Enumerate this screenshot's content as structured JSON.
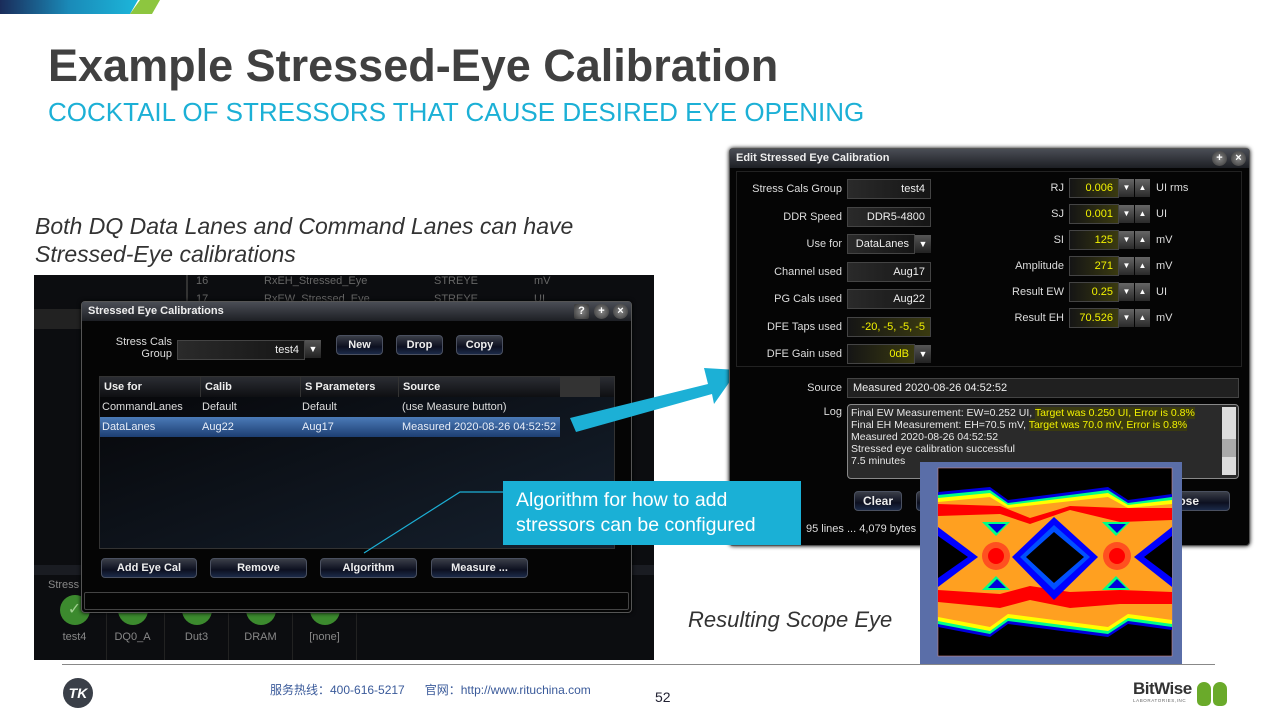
{
  "slide": {
    "title": "Example Stressed-Eye Calibration",
    "subtitle": "COCKTAIL OF STRESSORS THAT CAUSE DESIRED EYE OPENING",
    "note_line1": "Both DQ Data Lanes and Command Lanes can have",
    "note_line2": "Stressed-Eye calibrations",
    "callout_line1": "Algorithm for how to add",
    "callout_line2": "stressors can be configured",
    "scope_caption": "Resulting Scope Eye",
    "page_number": "52",
    "footer_hotline": "服务热线：400-616-5217",
    "footer_web": "官网：http://www.rituchina.com",
    "brand_logo": "BitWise",
    "brand_sub": "LABORATORIES,INC",
    "left_logo": "TK",
    "accent": "#1cb0d6",
    "accent_green": "#8dc63f"
  },
  "background_app": {
    "rows": [
      {
        "num": "16",
        "name": "RxEH_Stressed_Eye",
        "type": "STREYE",
        "unit": "mV"
      },
      {
        "num": "17",
        "name": "RxEW_Stressed_Eye",
        "type": "STREYE",
        "unit": "UI"
      }
    ],
    "tiles_label": "Stress",
    "tiles": [
      "test4",
      "DQ0_A",
      "Dut3",
      "DRAM",
      "[none]"
    ]
  },
  "cal_dialog": {
    "title": "Stressed Eye Calibrations",
    "group_label1": "Stress Cals",
    "group_label2": "Group",
    "group_value": "test4",
    "buttons": {
      "new": "New",
      "drop": "Drop",
      "copy": "Copy",
      "add": "Add Eye Cal",
      "remove": "Remove",
      "algorithm": "Algorithm",
      "measure": "Measure ..."
    },
    "columns": [
      "Use for",
      "Calib",
      "S Parameters",
      "Source"
    ],
    "rows": [
      [
        "CommandLanes",
        "Default",
        "Default",
        "(use Measure button)"
      ],
      [
        "DataLanes",
        "Aug22",
        "Aug17",
        "Measured 2020-08-26 04:52:52"
      ]
    ],
    "selected_row": 1
  },
  "edit_dialog": {
    "title": "Edit Stressed Eye Calibration",
    "left": [
      {
        "label": "Stress Cals Group",
        "value": "test4"
      },
      {
        "label": "DDR Speed",
        "value": "DDR5-4800"
      },
      {
        "label": "Use for",
        "value": "DataLanes",
        "dropdown": true
      },
      {
        "label": "Channel used",
        "value": "Aug17"
      },
      {
        "label": "PG Cals used",
        "value": "Aug22"
      },
      {
        "label": "DFE Taps used",
        "value": "-20, -5, -5, -5",
        "highlight": true
      },
      {
        "label": "DFE Gain used",
        "value": "0dB",
        "highlight": true,
        "dropdown": true
      }
    ],
    "right": [
      {
        "label": "RJ",
        "value": "0.006",
        "unit": "UI rms"
      },
      {
        "label": "SJ",
        "value": "0.001",
        "unit": "UI"
      },
      {
        "label": "SI",
        "value": "125",
        "unit": "mV"
      },
      {
        "label": "Amplitude",
        "value": "271",
        "unit": "mV"
      },
      {
        "label": "Result EW",
        "value": "0.25",
        "unit": "UI"
      },
      {
        "label": "Result EH",
        "value": "70.526",
        "unit": "mV"
      }
    ],
    "source_label": "Source",
    "source_value": "Measured 2020-08-26 04:52:52",
    "log_label": "Log",
    "log": [
      {
        "a": "Final EW Measurement: EW=0.252 UI, ",
        "b": "Target was 0.250 UI, Error is 0.8%"
      },
      {
        "a": "Final EH Measurement: EH=70.5 mV, ",
        "b": "Target was 70.0 mV, Error is 0.8%"
      },
      {
        "a": "Measured 2020-08-26 04:52:52",
        "b": ""
      },
      {
        "a": "Stressed eye calibration successful",
        "b": ""
      },
      {
        "a": "7.5 minutes",
        "b": ""
      }
    ],
    "clear": "Clear",
    "close_partial": "ose",
    "status": "95 lines ... 4,079 bytes"
  }
}
